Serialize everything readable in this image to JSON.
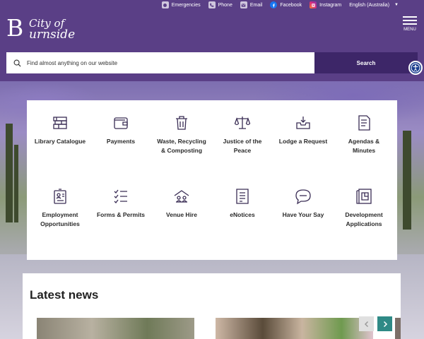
{
  "topbar": {
    "links": [
      {
        "label": "Emergencies",
        "icon": "info-icon"
      },
      {
        "label": "Phone",
        "icon": "phone-icon"
      },
      {
        "label": "Email",
        "icon": "email-icon"
      },
      {
        "label": "Facebook",
        "icon": "facebook-icon"
      },
      {
        "label": "Instagram",
        "icon": "instagram-icon"
      }
    ],
    "language": "English (Australia)"
  },
  "logo": {
    "big": "B",
    "small": "City of",
    "main": "urnside"
  },
  "menu": {
    "label": "MENU"
  },
  "search": {
    "placeholder": "Find almost anything on our website",
    "button": "Search"
  },
  "quick_links": [
    {
      "label": "Library Catalogue",
      "icon": "library-icon"
    },
    {
      "label": "Payments",
      "icon": "wallet-icon"
    },
    {
      "label": "Waste, Recycling & Composting",
      "icon": "bin-icon"
    },
    {
      "label": "Justice of the Peace",
      "icon": "scales-icon"
    },
    {
      "label": "Lodge a Request",
      "icon": "inbox-icon"
    },
    {
      "label": "Agendas & Minutes",
      "icon": "document-icon"
    },
    {
      "label": "Employment Opportunities",
      "icon": "id-card-icon"
    },
    {
      "label": "Forms & Permits",
      "icon": "checklist-icon"
    },
    {
      "label": "Venue Hire",
      "icon": "building-icon"
    },
    {
      "label": "eNotices",
      "icon": "notice-icon"
    },
    {
      "label": "Have Your Say",
      "icon": "speech-icon"
    },
    {
      "label": "Development Applications",
      "icon": "plan-icon"
    }
  ],
  "news": {
    "title": "Latest news"
  },
  "colors": {
    "brand": "#5a3f86",
    "search_button": "#3d2668",
    "carousel_next": "#2f8a86"
  }
}
